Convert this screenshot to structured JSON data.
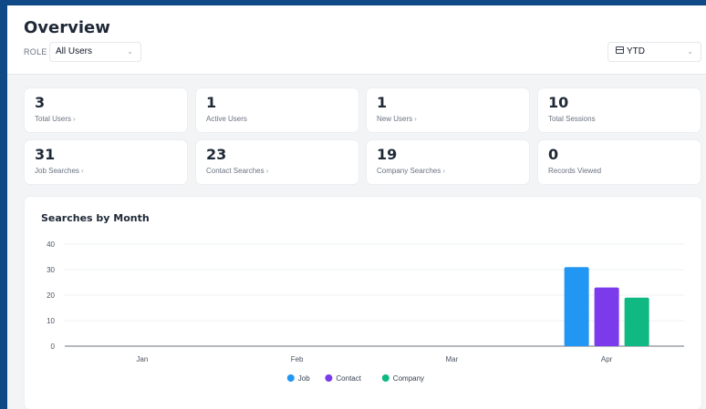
{
  "header": {
    "title": "Overview",
    "role_label": "ROLE",
    "role_value": "All Users",
    "period_value": "YTD"
  },
  "stats": [
    {
      "value": "3",
      "label": "Total Users",
      "link": true
    },
    {
      "value": "1",
      "label": "Active Users",
      "link": false
    },
    {
      "value": "1",
      "label": "New Users",
      "link": true
    },
    {
      "value": "10",
      "label": "Total Sessions",
      "link": false
    },
    {
      "value": "31",
      "label": "Job Searches",
      "link": true
    },
    {
      "value": "23",
      "label": "Contact Searches",
      "link": true
    },
    {
      "value": "19",
      "label": "Company Searches",
      "link": true
    },
    {
      "value": "0",
      "label": "Records Viewed",
      "link": false
    }
  ],
  "icons": {
    "chevron": "chevron-down-icon",
    "calendar": "calendar-icon",
    "stat_link": "chevron-right-icon"
  },
  "colors": {
    "job": "#2196f3",
    "contact": "#7c3aed",
    "company": "#10b981"
  },
  "chart_data": {
    "type": "bar",
    "title": "Searches by Month",
    "categories": [
      "Jan",
      "Feb",
      "Mar",
      "Apr"
    ],
    "series": [
      {
        "name": "Job",
        "values": [
          0,
          0,
          0,
          31
        ]
      },
      {
        "name": "Contact",
        "values": [
          0,
          0,
          0,
          23
        ]
      },
      {
        "name": "Company",
        "values": [
          0,
          0,
          0,
          19
        ]
      }
    ],
    "yticks": [
      0,
      10,
      20,
      30,
      40
    ],
    "ylim": [
      0,
      40
    ],
    "grid": true,
    "legend": "bottom-center"
  }
}
